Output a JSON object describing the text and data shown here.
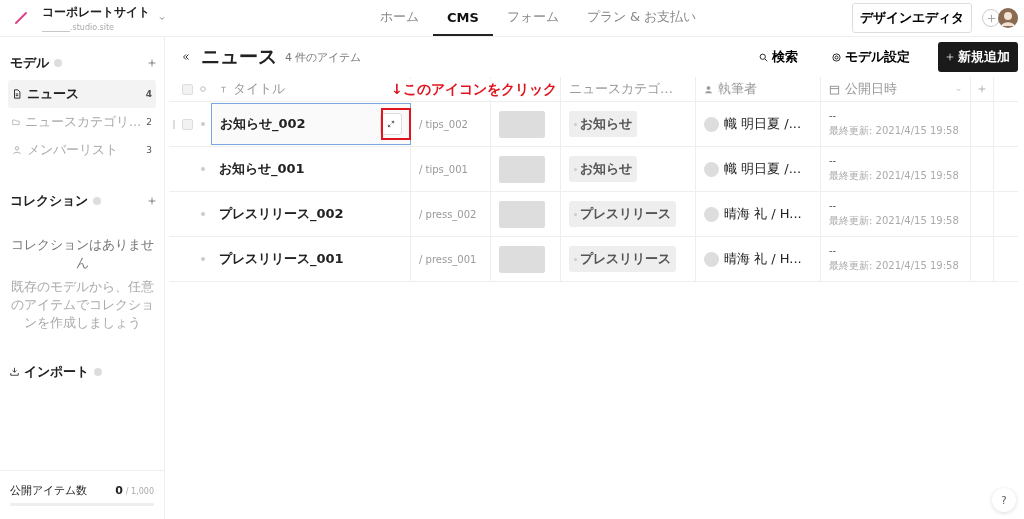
{
  "header": {
    "site_name": "コーポレートサイト",
    "site_url": "_______.studio.site",
    "nav": [
      {
        "label": "ホーム",
        "selected": false
      },
      {
        "label": "CMS",
        "selected": true
      },
      {
        "label": "フォーム",
        "selected": false
      },
      {
        "label": "プラン & お支払い",
        "selected": false
      }
    ],
    "design_editor": "デザインエディタ"
  },
  "sidebar": {
    "models_title": "モデル",
    "models": [
      {
        "label": "ニュース",
        "count": "4",
        "selected": true,
        "kind": "document"
      },
      {
        "label": "ニュースカテゴリ...",
        "count": "2",
        "selected": false,
        "kind": "folder"
      },
      {
        "label": "メンバーリスト",
        "count": "3",
        "selected": false,
        "kind": "person"
      }
    ],
    "collections_title": "コレクション",
    "collections_empty": "コレクションはありません",
    "collections_hint": "既存のモデルから、任意のアイテムでコレクションを作成しましょう",
    "import": "インポート",
    "footer": {
      "label": "公開アイテム数",
      "value": "0",
      "limit": "/ 1,000",
      "level": 0
    }
  },
  "main": {
    "title": "ニュース",
    "count": "4 件のアイテム",
    "search": "検索",
    "model_settings": "モデル設定",
    "add": "新規追加"
  },
  "table": {
    "select_all_checked": false,
    "columns": [
      {
        "label": "タイトル",
        "kind": "text"
      },
      {
        "label": "ニュースカテゴ…",
        "kind": "plain"
      },
      {
        "label": "執筆者",
        "kind": "person"
      },
      {
        "label": "公開日時",
        "kind": "date"
      }
    ],
    "rows": [
      {
        "title": "お知らせ_002",
        "slug": "/ tips_002",
        "category": "お知らせ",
        "author": "幟 明日夏 /...",
        "date": "--",
        "updated": "最終更新: 2021/4/15 19:58",
        "selected": true,
        "checked": false
      },
      {
        "title": "お知らせ_001",
        "slug": "/ tips_001",
        "category": "お知らせ",
        "author": "幟 明日夏 /...",
        "date": "--",
        "updated": "最終更新: 2021/4/15 19:58",
        "selected": false
      },
      {
        "title": "プレスリリース_002",
        "slug": "/ press_002",
        "category": "プレスリリース",
        "author": "晴海 礼 / H...",
        "date": "--",
        "updated": "最終更新: 2021/4/15 19:58",
        "selected": false
      },
      {
        "title": "プレスリリース_001",
        "slug": "/ press_001",
        "category": "プレスリリース",
        "author": "晴海 礼 / H...",
        "date": "--",
        "updated": "最終更新: 2021/4/15 19:58",
        "selected": false
      }
    ]
  },
  "annotation": "↓このアイコンをクリック",
  "help": "?"
}
